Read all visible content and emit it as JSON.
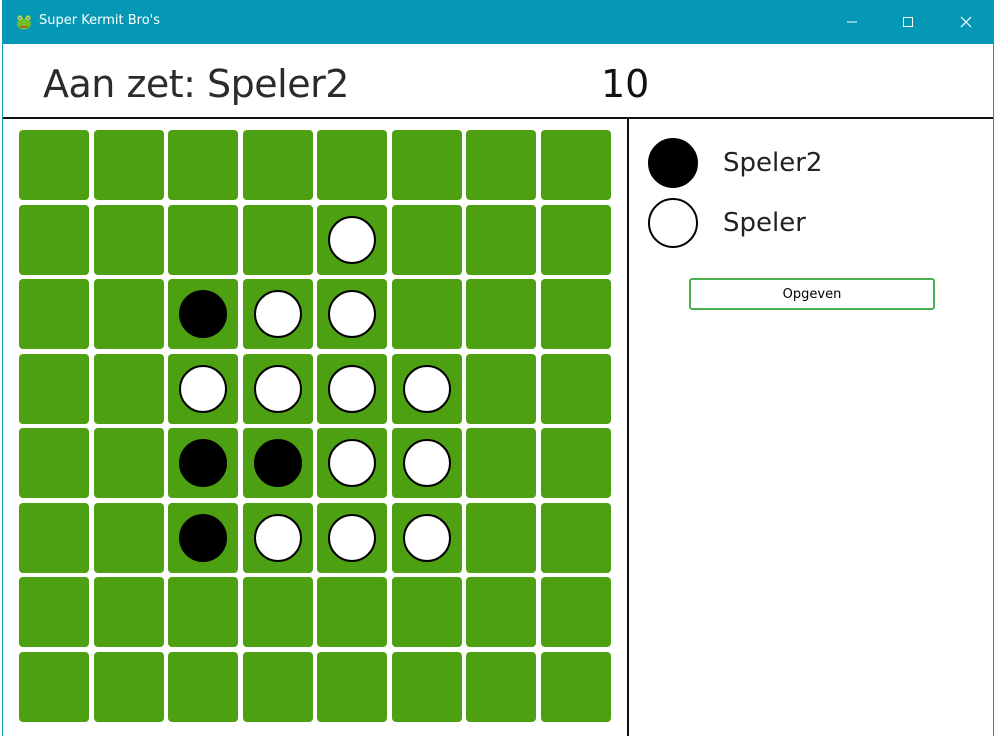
{
  "window": {
    "title": "Super Kermit Bro's",
    "icon": "frog-icon",
    "controls": [
      "minimize-icon",
      "maximize-icon",
      "close-icon"
    ],
    "titlebar_color": "#0598b6"
  },
  "header": {
    "turn_label": "Aan zet: Speler2",
    "score": "10"
  },
  "board": {
    "size": 8,
    "cell_color": "#4ea013",
    "rows": [
      [
        "",
        "",
        "",
        "",
        "",
        "",
        "",
        ""
      ],
      [
        "",
        "",
        "",
        "",
        "W",
        "",
        "",
        ""
      ],
      [
        "",
        "",
        "B",
        "W",
        "W",
        "",
        "",
        ""
      ],
      [
        "",
        "",
        "W",
        "W",
        "W",
        "W",
        "",
        ""
      ],
      [
        "",
        "",
        "B",
        "B",
        "W",
        "W",
        "",
        ""
      ],
      [
        "",
        "",
        "B",
        "W",
        "W",
        "W",
        "",
        ""
      ],
      [
        "",
        "",
        "",
        "",
        "",
        "",
        "",
        ""
      ],
      [
        "",
        "",
        "",
        "",
        "",
        "",
        "",
        ""
      ]
    ]
  },
  "players": [
    {
      "name": "Speler2",
      "color": "black"
    },
    {
      "name": "Speler",
      "color": "white"
    }
  ],
  "actions": {
    "give_up_label": "Opgeven",
    "give_up_border_color": "#4caf50"
  }
}
